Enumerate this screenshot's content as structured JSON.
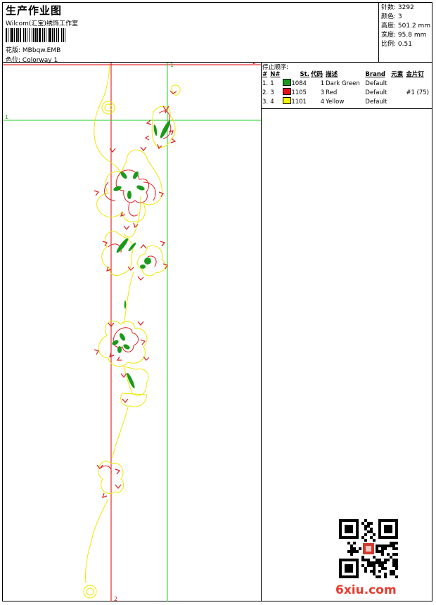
{
  "header": {
    "title": "生产作业图",
    "company": "Wilcom(汇宝)绣饰工作室",
    "design_label": "花版:",
    "design_value": "MBbqw.EMB",
    "colorway_label": "色位:",
    "colorway_value": "Colorway 1"
  },
  "stats": [
    {
      "label": "针数:",
      "value": "3292"
    },
    {
      "label": "颜色:",
      "value": "3"
    },
    {
      "label": "高度:",
      "value": "501.2 mm"
    },
    {
      "label": "宽度:",
      "value": "95.8 mm"
    },
    {
      "label": "比例:",
      "value": "0.51"
    }
  ],
  "sequence": {
    "title": "停止顺序:",
    "columns": [
      "#",
      "N#",
      "St.",
      "代码",
      "描述",
      "Brand",
      "元素",
      "金片钉"
    ],
    "rows": [
      {
        "idx": "1.",
        "n": "1",
        "color": "#1a9a1a",
        "st": "1084",
        "code": "1",
        "desc": "Dark Green",
        "brand": "Default",
        "element": "",
        "sequin": ""
      },
      {
        "idx": "2.",
        "n": "3",
        "color": "#e81010",
        "st": "1105",
        "code": "3",
        "desc": "Red",
        "brand": "Default",
        "element": "",
        "sequin": "#1 (75)"
      },
      {
        "idx": "3.",
        "n": "4",
        "color": "#f4f400",
        "st": "1101",
        "code": "4",
        "desc": "Yellow",
        "brand": "Default",
        "element": "",
        "sequin": ""
      }
    ]
  },
  "guides": {
    "top_left": "1",
    "top_right": "2",
    "left": "1",
    "bottom": "2"
  },
  "watermark": "6xiu.com",
  "colors": {
    "yellow": "#ece800",
    "red": "#e02020",
    "green": "#1a9a1a",
    "guide_red": "#e00000",
    "guide_green": "#22cc22"
  }
}
